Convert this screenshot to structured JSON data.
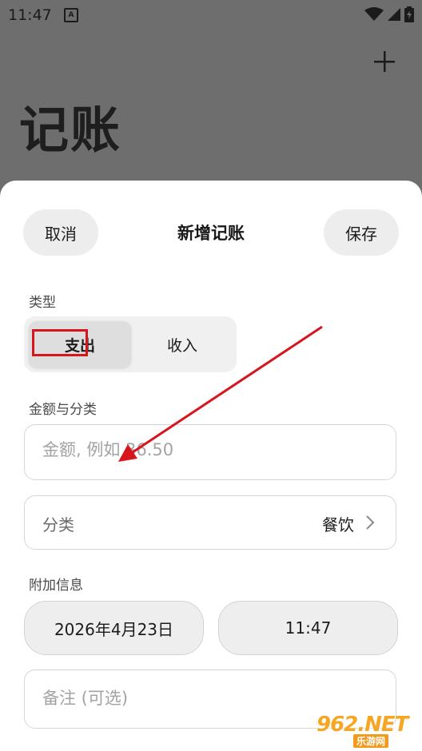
{
  "status_bar": {
    "time": "11:47",
    "notification_glyph": "A"
  },
  "background": {
    "title": "记账",
    "add_icon": "plus-icon"
  },
  "sheet": {
    "title": "新增记账",
    "cancel_label": "取消",
    "save_label": "保存",
    "type_section_label": "类型",
    "type_options": [
      "支出",
      "收入"
    ],
    "type_selected": "支出",
    "amount_section_label": "金额与分类",
    "amount_placeholder": "金额, 例如 36.50",
    "category_label": "分类",
    "category_value": "餐饮",
    "extra_section_label": "附加信息",
    "date_value": "2026年4月23日",
    "time_value": "11:47",
    "note_placeholder": "备注 (可选)"
  },
  "annotation": {
    "arrow_color": "#d8141c",
    "box_color": "#d8141c"
  },
  "watermark": {
    "main": "962.NET",
    "sub": "乐游网"
  }
}
